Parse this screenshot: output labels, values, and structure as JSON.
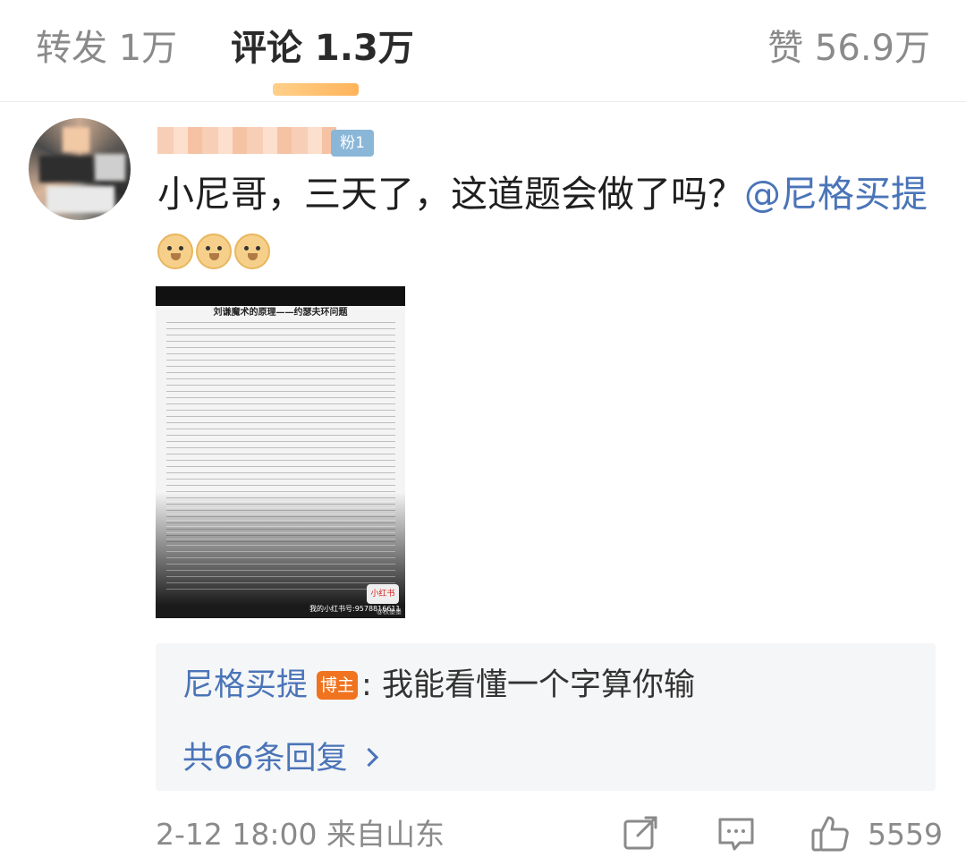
{
  "tabs": {
    "repost": "转发 1万",
    "comment": "评论 1.3万",
    "like": "赞 56.9万"
  },
  "comment": {
    "fan_badge": "粉1",
    "text": "小尼哥，三天了，这道题会做了吗？",
    "mention": "@尼格买提",
    "emoji": "doge-emoji",
    "image": {
      "title": "刘谦魔术的原理——约瑟夫环问题",
      "caption": "我的小红书号:9578816611",
      "logo": "小红书",
      "watermark": "@秋墨墨"
    }
  },
  "reply": {
    "author": "尼格买提",
    "badge": "博主",
    "separator": ":",
    "text": "我能看懂一个字算你输",
    "more": "共66条回复"
  },
  "footer": {
    "time": "2-12 18:00",
    "location": "来自山东",
    "likes": "5559"
  },
  "colors": {
    "link": "#4a74b8",
    "author_badge": "#f0731f",
    "fan_badge": "#8ab6d8",
    "muted": "#8a8a8a"
  }
}
